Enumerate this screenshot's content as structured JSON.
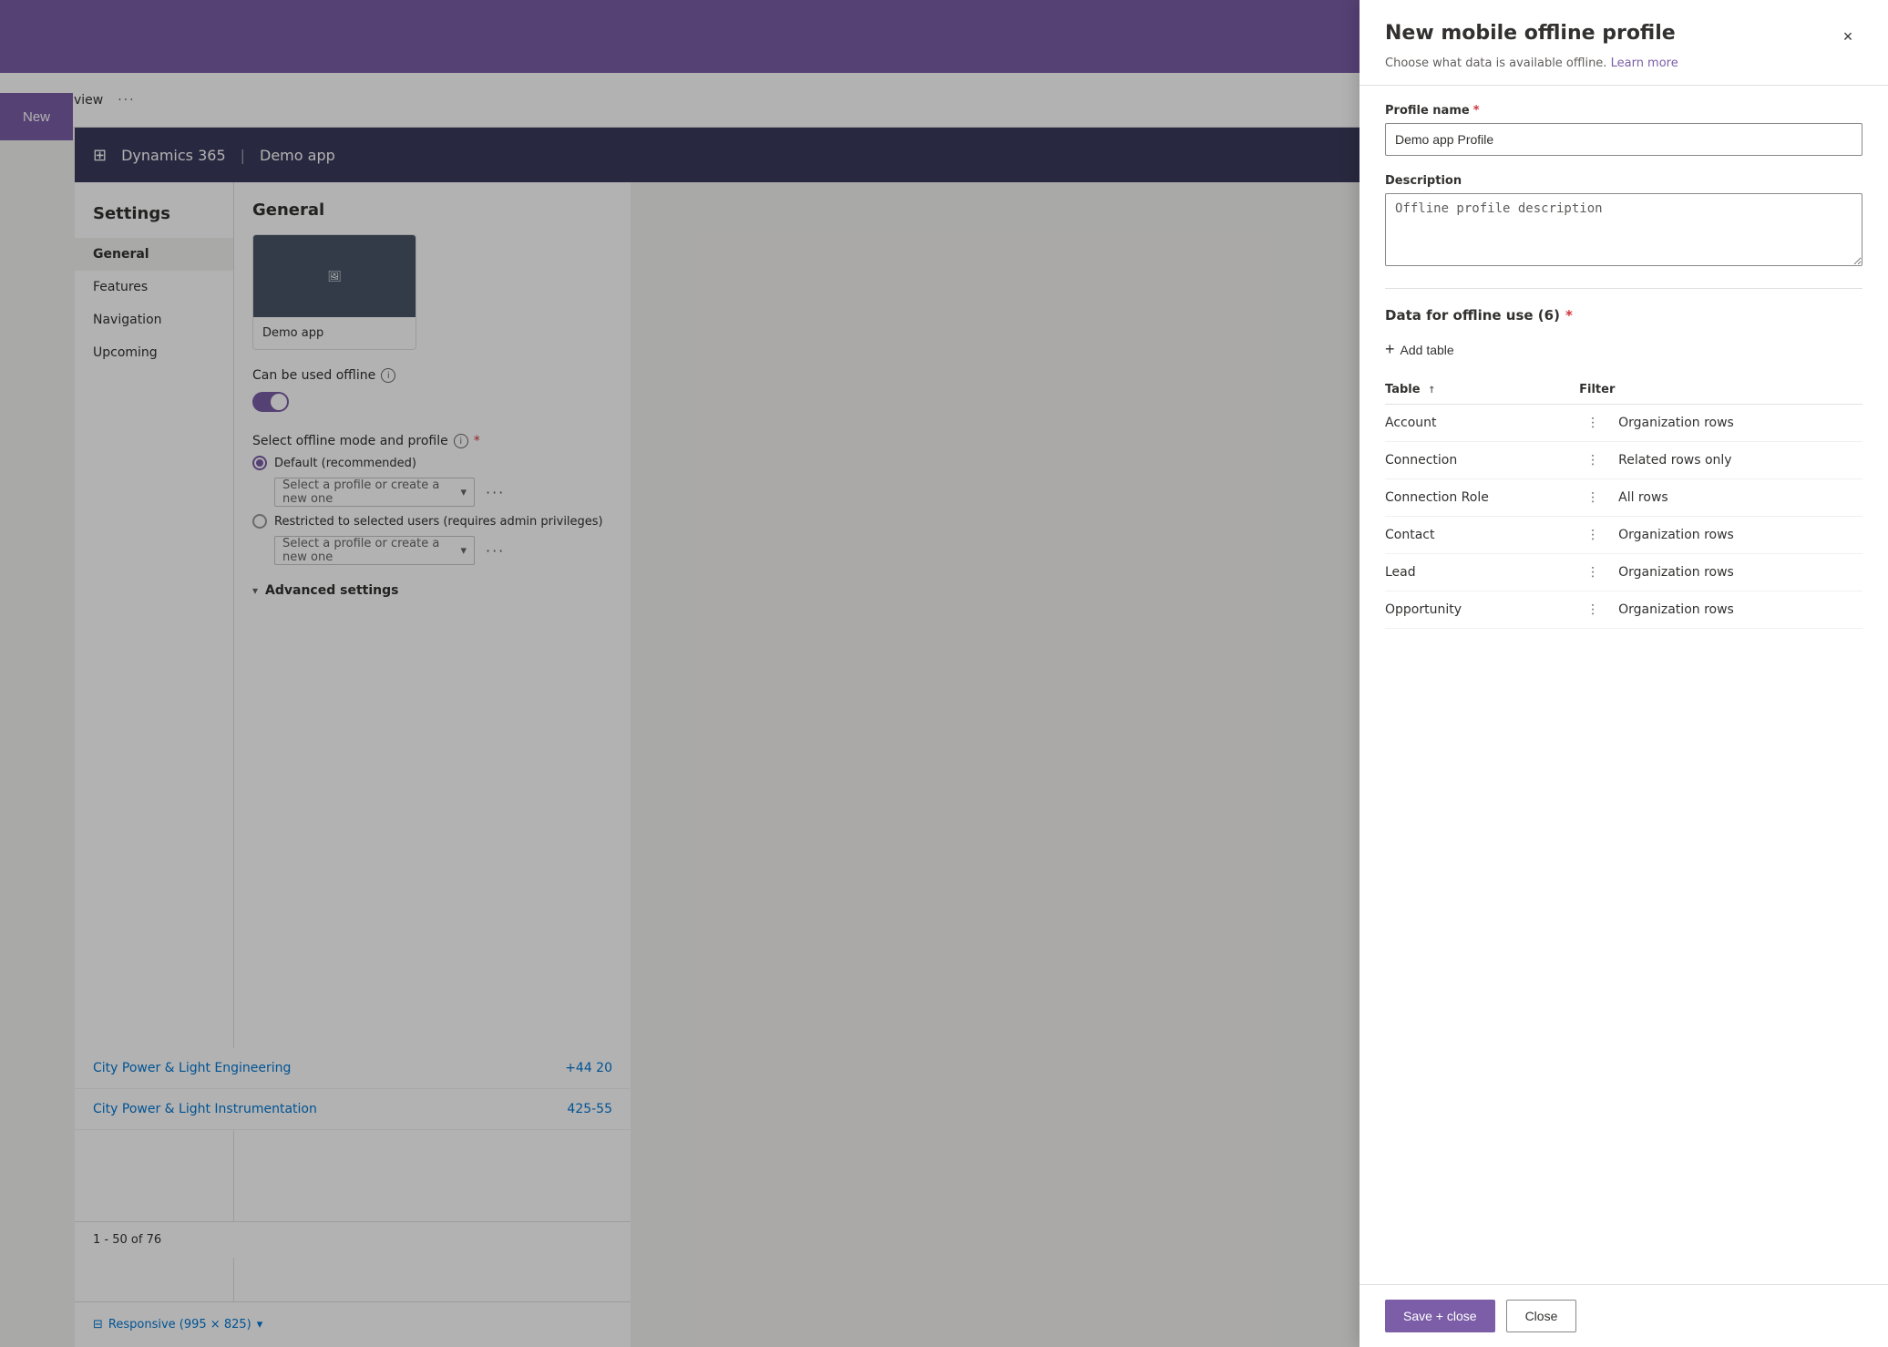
{
  "app": {
    "title": "Dynamics 365",
    "demo_app": "Demo app"
  },
  "topbar": {
    "edit_view": "Edit view",
    "dots": "···"
  },
  "new_button": "New",
  "sidebar": {
    "title": "Settings",
    "items": [
      {
        "label": "General",
        "active": true
      },
      {
        "label": "Features",
        "active": false
      },
      {
        "label": "Navigation",
        "active": false
      },
      {
        "label": "Upcoming",
        "active": false
      }
    ]
  },
  "main": {
    "title": "General",
    "app_card_name": "Demo app",
    "offline_label": "Can be used offline",
    "select_mode_label": "Select offline mode and profile",
    "default_option": "Default (recommended)",
    "restricted_option": "Restricted to selected users (requires admin privileges)",
    "profile_placeholder": "Select a profile or create a new one",
    "profile_placeholder2": "Select a profile or create a new one",
    "advanced_settings": "Advanced settings"
  },
  "bg_table": {
    "rows": [
      {
        "name": "City Power & Light Engineering",
        "phone": "+44 20"
      },
      {
        "name": "City Power & Light Instrumentation",
        "phone": "425-55"
      }
    ],
    "pagination": "1 - 50 of 76",
    "responsive": "Responsive (995 × 825)"
  },
  "modal": {
    "title": "New mobile offline profile",
    "subtitle": "Choose what data is available offline.",
    "learn_more": "Learn more",
    "close_label": "×",
    "profile_name_label": "Profile name",
    "profile_name_required": true,
    "profile_name_value": "Demo app Profile",
    "description_label": "Description",
    "description_value": "Offline profile description",
    "data_section_title": "Data for offline use (6)",
    "data_required": true,
    "add_table_label": "Add table",
    "table_headers": {
      "table": "Table",
      "filter": "Filter"
    },
    "sort_indicator": "↑",
    "rows": [
      {
        "table": "Account",
        "filter": "Organization rows"
      },
      {
        "table": "Connection",
        "filter": "Related rows only"
      },
      {
        "table": "Connection Role",
        "filter": "All rows"
      },
      {
        "table": "Contact",
        "filter": "Organization rows"
      },
      {
        "table": "Lead",
        "filter": "Organization rows"
      },
      {
        "table": "Opportunity",
        "filter": "Organization rows"
      }
    ],
    "save_button": "Save + close",
    "close_button": "Close"
  }
}
